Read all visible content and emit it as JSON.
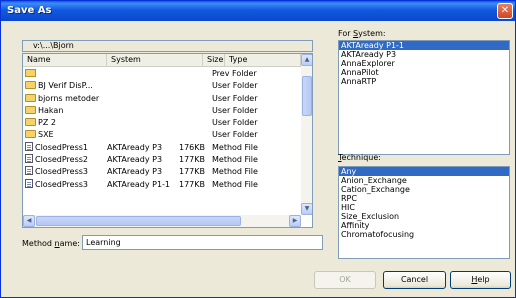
{
  "window": {
    "title": "Save As"
  },
  "path": "v:\\...\\Bjorn",
  "file_list": {
    "columns": [
      "Name",
      "System",
      "Size",
      "Type"
    ],
    "rows": [
      {
        "icon": "up-folder-icon",
        "name": "",
        "system": "",
        "size": "",
        "type": "Prev Folder"
      },
      {
        "icon": "folder-icon",
        "name": "BJ Verif DisP...",
        "system": "",
        "size": "",
        "type": "User Folder"
      },
      {
        "icon": "folder-icon",
        "name": "bjorns metoder",
        "system": "",
        "size": "",
        "type": "User Folder"
      },
      {
        "icon": "folder-icon",
        "name": "Hakan",
        "system": "",
        "size": "",
        "type": "User Folder"
      },
      {
        "icon": "folder-icon",
        "name": "PZ 2",
        "system": "",
        "size": "",
        "type": "User Folder"
      },
      {
        "icon": "folder-icon",
        "name": "SXE",
        "system": "",
        "size": "",
        "type": "User Folder"
      },
      {
        "icon": "method-file-icon",
        "name": "ClosedPress1",
        "system": "AKTAready P3",
        "size": "176KB",
        "type": "Method File"
      },
      {
        "icon": "method-file-icon",
        "name": "ClosedPress2",
        "system": "AKTAready P3",
        "size": "177KB",
        "type": "Method File"
      },
      {
        "icon": "method-file-icon",
        "name": "ClosedPress3",
        "system": "AKTAready P3",
        "size": "177KB",
        "type": "Method File"
      },
      {
        "icon": "method-file-icon",
        "name": "ClosedPress3",
        "system": "AKTAready P1-1",
        "size": "177KB",
        "type": "Method File"
      }
    ]
  },
  "method_name": {
    "label_prefix": "Method ",
    "label_accel": "n",
    "label_suffix": "ame:",
    "value": "Learning"
  },
  "for_system": {
    "label_prefix": "For ",
    "label_accel": "S",
    "label_suffix": "ystem:",
    "items": [
      "AKTAready P1-1",
      "AKTAready P3",
      "AnnaExplorer",
      "AnnaPilot",
      "AnnaRTP"
    ],
    "selected_index": 0
  },
  "technique": {
    "label_accel": "T",
    "label_suffix": "echnique:",
    "items": [
      "Any",
      "Anion_Exchange",
      "Cation_Exchange",
      "RPC",
      "HIC",
      "Size_Exclusion",
      "Affinity",
      "Chromatofocusing"
    ],
    "selected_index": 0
  },
  "buttons": {
    "ok": "OK",
    "cancel": "Cancel",
    "help_accel": "H",
    "help_suffix": "elp"
  },
  "icons": {
    "close": "close-icon",
    "scroll_up": "scroll-up-icon",
    "scroll_down": "scroll-down-icon",
    "scroll_left": "scroll-left-icon",
    "scroll_right": "scroll-right-icon"
  },
  "colors": {
    "titlebar": "#0a47cc",
    "selection": "#316ac5",
    "dialog_bg": "#ece9d8"
  }
}
